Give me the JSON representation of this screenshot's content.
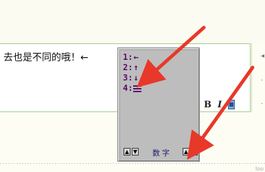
{
  "editor": {
    "text": "去也是不同的哦！←"
  },
  "toolbar": {
    "bold_label": "B",
    "italic_label": "I",
    "media_icon": "film-icon"
  },
  "ime": {
    "candidates": [
      {
        "num": "1:",
        "symbol": "←"
      },
      {
        "num": "2:",
        "symbol": "↑"
      },
      {
        "num": "3:",
        "symbol": "↓"
      },
      {
        "num": "4:",
        "symbol": "≡"
      }
    ],
    "mode_label": "数字",
    "left_nav": [
      "▲",
      "▼"
    ],
    "right_nav": [
      "▲",
      "▼"
    ]
  },
  "annotation": {
    "arrow_color": "#e8382a"
  },
  "side_glyphs": [
    "◂",
    "·",
    "·"
  ],
  "corner_text": "loo"
}
